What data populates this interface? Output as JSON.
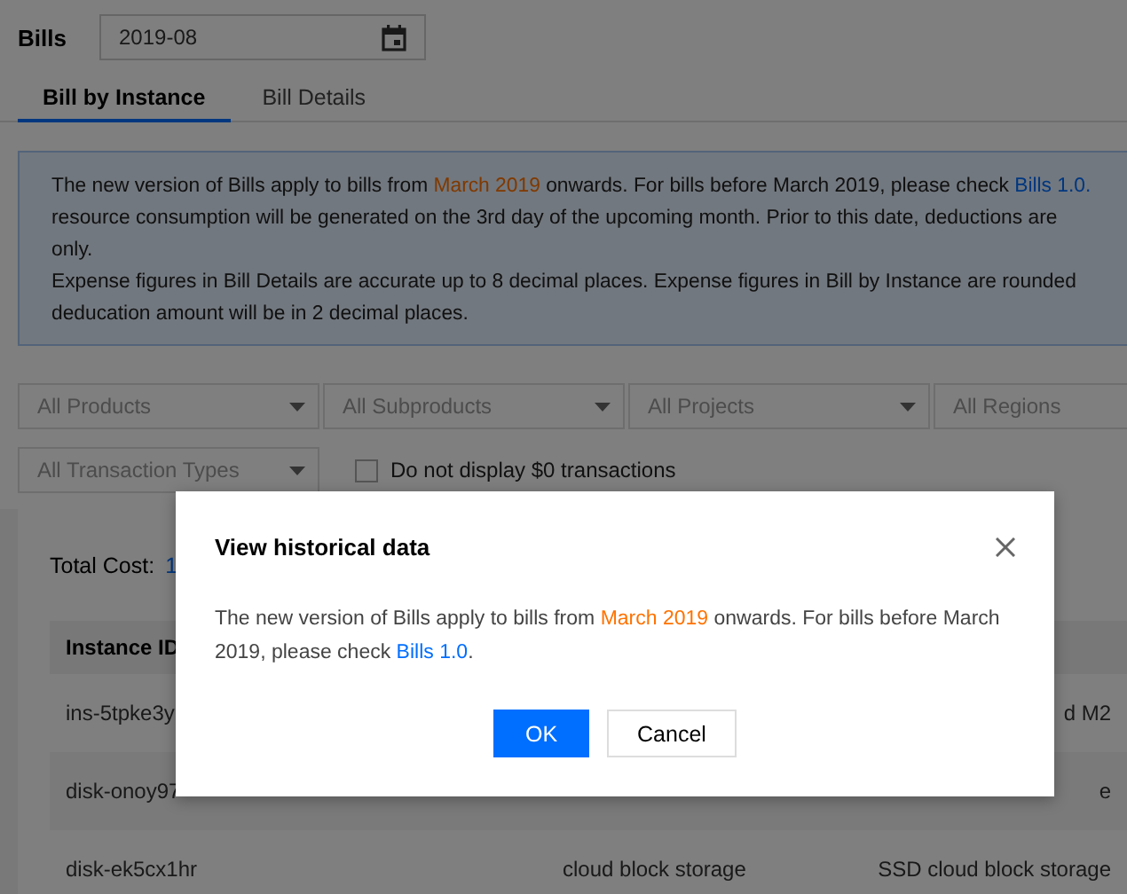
{
  "header": {
    "title": "Bills",
    "date_field": {
      "value": "2019-08"
    }
  },
  "tabs": [
    {
      "label": "Bill by Instance",
      "selected": true
    },
    {
      "label": "Bill Details",
      "selected": false
    }
  ],
  "notice": {
    "lines": [
      [
        {
          "kind": "text",
          "text": "The new version of Bills apply to bills from "
        },
        {
          "kind": "highlight",
          "text": "March 2019"
        },
        {
          "kind": "text",
          "text": " onwards. For bills before March 2019, please check "
        },
        {
          "kind": "link",
          "text": "Bills 1.0."
        }
      ],
      [
        {
          "kind": "text",
          "text": "resource consumption will be generated on the 3rd day of the upcoming month. Prior to this date, deductions are"
        }
      ],
      [
        {
          "kind": "text",
          "text": "only."
        }
      ],
      [
        {
          "kind": "text",
          "text": "Expense figures in Bill Details are accurate up to 8 decimal places. Expense figures in Bill by Instance are rounded"
        }
      ],
      [
        {
          "kind": "text",
          "text": "deducation amount will be in 2 decimal places."
        }
      ]
    ]
  },
  "filters": [
    {
      "kind": "dropdown",
      "label": "All Products"
    },
    {
      "kind": "dropdown",
      "label": "All Subproducts"
    },
    {
      "kind": "dropdown",
      "label": "All Projects"
    },
    {
      "kind": "dropdown",
      "label": "All Regions"
    },
    {
      "kind": "dropdown",
      "label": "All Transaction Types"
    },
    {
      "kind": "checkbox",
      "label": "Do not display $0 transactions",
      "checked": false
    }
  ],
  "total": {
    "label": "Total Cost:",
    "value": "1"
  },
  "table": {
    "columns": [
      "Instance ID"
    ],
    "rows": [
      {
        "instance_id": "ins-5tpke3y",
        "column_4": "d M2"
      },
      {
        "instance_id": "disk-onoy97",
        "column_4": "e"
      },
      {
        "instance_id": "disk-ek5cx1hr",
        "column_3": "cloud block storage",
        "column_4": "SSD cloud block storage"
      }
    ]
  },
  "modal": {
    "title": "View historical data",
    "body": [
      {
        "kind": "text",
        "text": "The new version of Bills apply to bills from "
      },
      {
        "kind": "highlight",
        "text": "March 2019"
      },
      {
        "kind": "text",
        "text": " onwards. For bills before March 2019, please check "
      },
      {
        "kind": "link",
        "text": "Bills 1.0"
      },
      {
        "kind": "text",
        "text": "."
      }
    ],
    "buttons": [
      {
        "label": "OK",
        "kind": "primary"
      },
      {
        "label": "Cancel",
        "kind": "secondary"
      }
    ]
  }
}
